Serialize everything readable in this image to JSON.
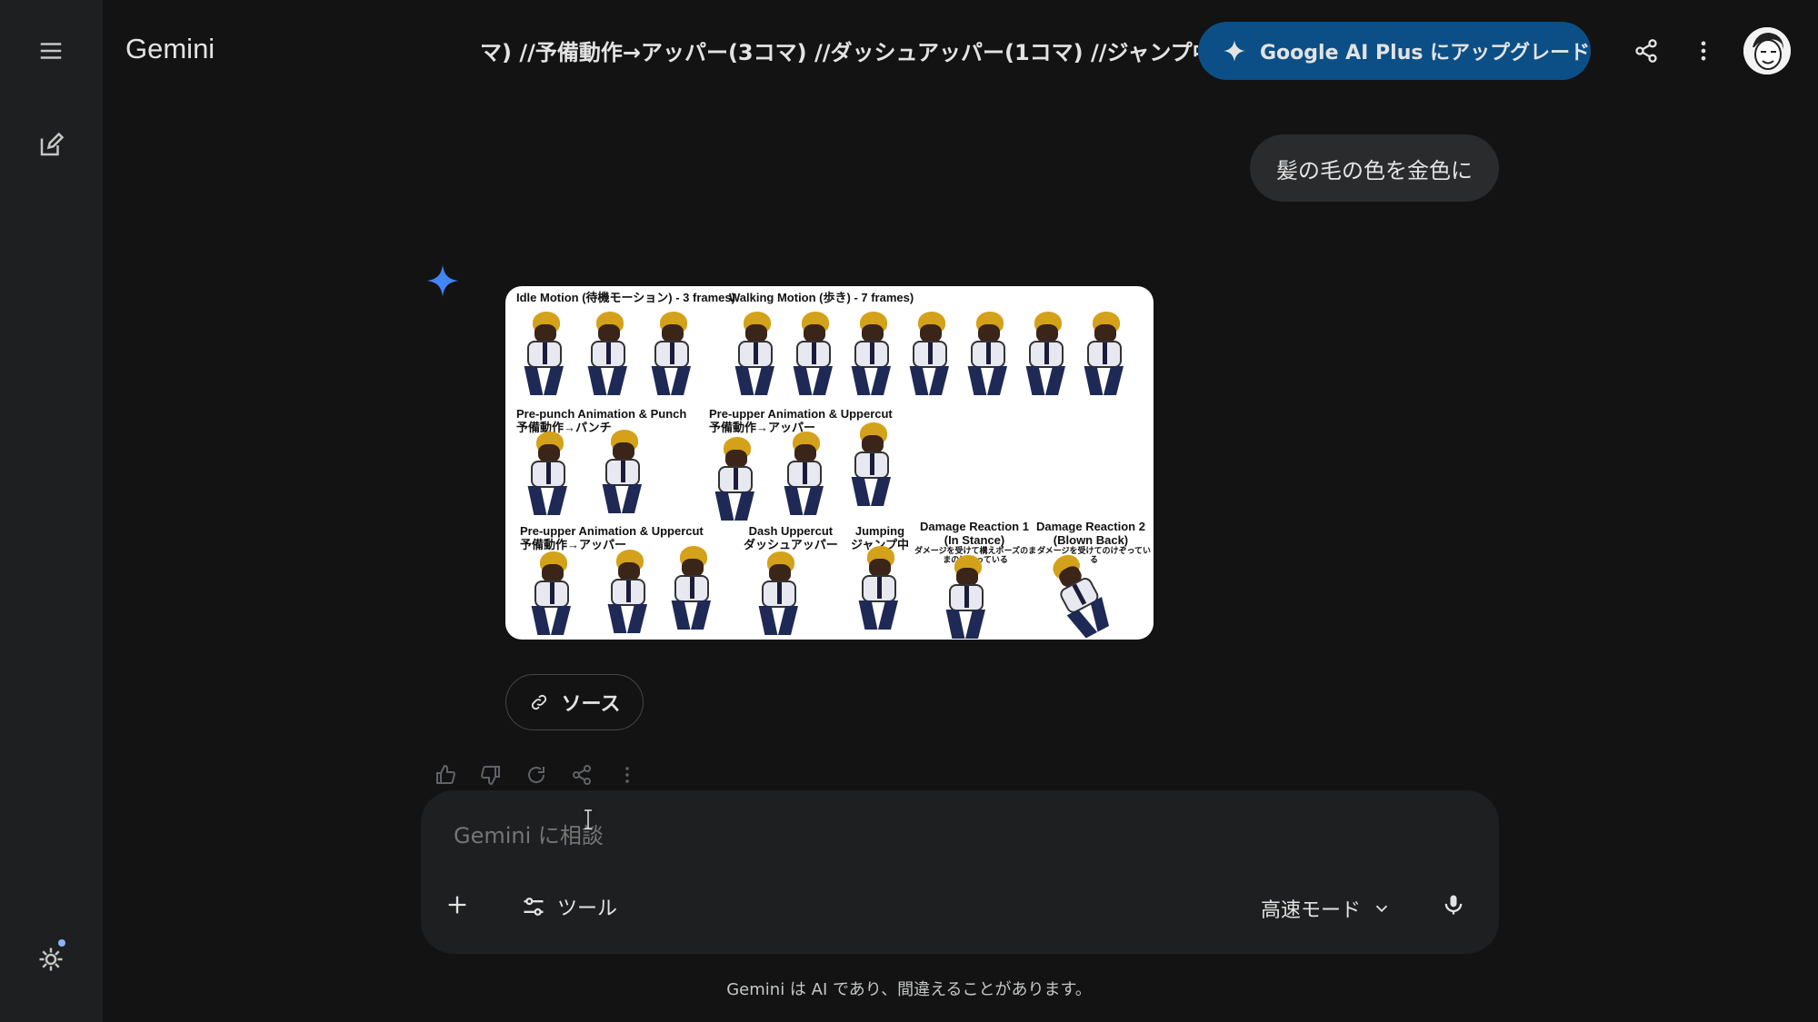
{
  "app": {
    "brand": "Gemini",
    "conversation_title": "マ) //予備動作→アッパー(3コマ) //ダッシュアッパー(1コマ) //ジャンプ中",
    "upgrade_label": "Google AI Plus にアップグレード"
  },
  "icons": {
    "menu": "menu-icon",
    "new_chat": "edit-icon",
    "settings": "gear-icon",
    "share": "share-icon",
    "more": "more-vert-icon",
    "sparkle": "gemini-sparkle-icon"
  },
  "colors": {
    "background": "#131314",
    "sidebar": "#1e1f20",
    "upgrade_button": "#0b4f86",
    "sparkle_blue": "#4285f4"
  },
  "chat": {
    "user_message": "髪の毛の色を金色に",
    "response_image": {
      "labels": {
        "idle": "Idle Motion (待機モーション) - 3 frames)",
        "walking": "Walking Motion (歩き) - 7 frames)",
        "prepunch": "Pre-punch Animation & Punch\n予備動作→パンチ",
        "preupper1": "Pre-upper Animation  & Uppercut\n予備動作→アッパー",
        "preupper2": "Pre-upper Animation & Uppercut\n予備動作→アッパー",
        "dash": "Dash Uppercut\nダッシュアッパー",
        "jumping": "Jumping\nジャンプ中",
        "damage1": "Damage Reaction 1\n(In Stance)",
        "damage1_note": "ダメージを受けて構えポーズのま\nまのけぞっている",
        "damage2": "Damage Reaction 2\n(Blown Back)",
        "damage2_note": "ダメージを受けてのけぞっている"
      }
    },
    "source_chip": "ソース"
  },
  "composer": {
    "placeholder": "Gemini に相談",
    "tools_label": "ツール",
    "mode_label": "高速モード"
  },
  "footer": {
    "disclaimer": "Gemini は AI であり、間違えることがあります。"
  }
}
